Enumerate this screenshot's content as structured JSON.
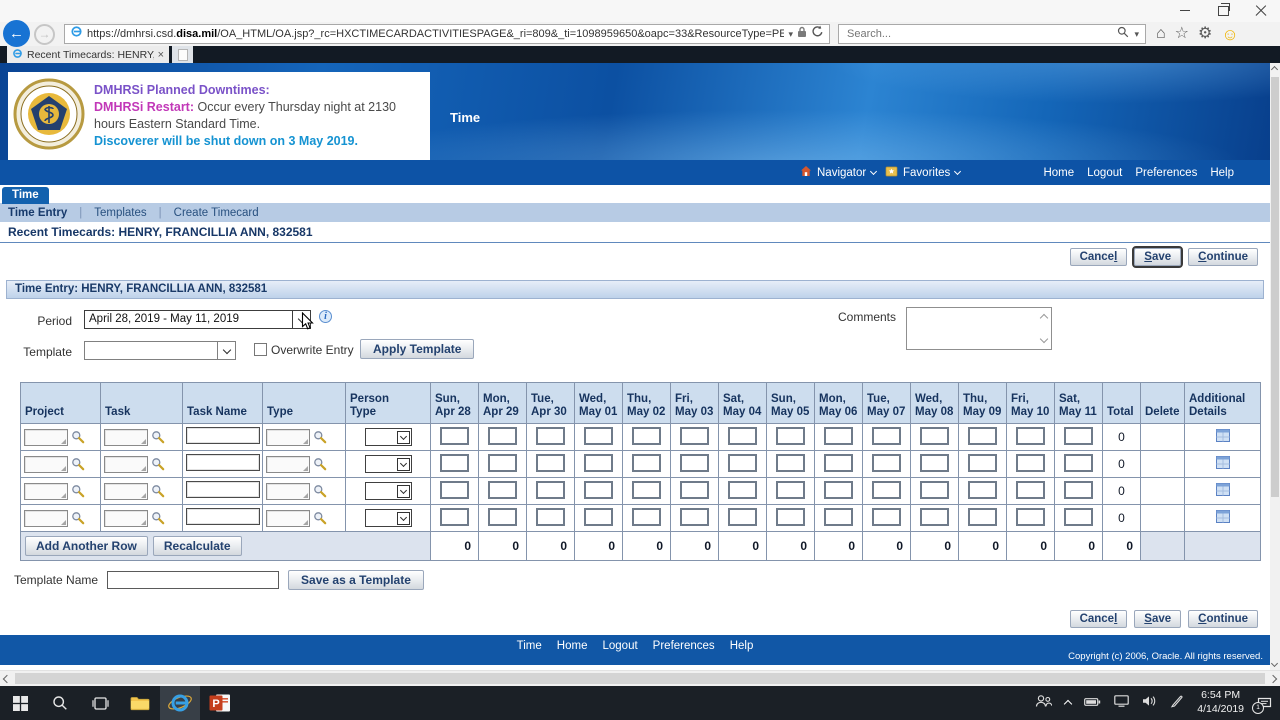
{
  "browser": {
    "url_prefix": "https://dmhrsi.csd.",
    "url_domain": "disa.mil",
    "url_path": "/OA_HTML/OA.jsp?_rc=HXCTIMECARDACTIVITIESPAGE&_ri=809&_ti=1098959650&oapc=33&ResourceType=PERSON&retainAM=Y&Actic",
    "search_placeholder": "Search...",
    "tab_title": "Recent Timecards: HENRY, ...",
    "icons": {
      "back": "←",
      "forward": "→",
      "url_caret": "▾",
      "search_caret": "▾",
      "home": "⌂",
      "star": "☆",
      "gear": "⚙",
      "smiley": "☺",
      "tab_close": "×",
      "info": "i"
    }
  },
  "banner": {
    "title": "DMHRSi Planned Downtimes:",
    "restart_label": "DMHRSi Restart:",
    "restart_text": " Occur every Thursday night at 2130 hours Eastern Standard Time.",
    "discoverer_text": "Discoverer will be shut down on 3 May 2019.",
    "colors": {
      "title": "#7a52c8",
      "restart": "#c238b8",
      "body": "#4a4a4a",
      "discoverer": "#1593d2"
    }
  },
  "header": {
    "app_title": "Time",
    "navigator_label": "Navigator",
    "favorites_label": "Favorites",
    "links": [
      "Home",
      "Logout",
      "Preferences",
      "Help"
    ]
  },
  "nav": {
    "tab": "Time",
    "items": [
      "Time Entry",
      "Templates",
      "Create Timecard"
    ]
  },
  "breadcrumb": "Recent Timecards: HENRY, FRANCILLIA ANN, 832581",
  "section_title": "Time Entry: HENRY, FRANCILLIA ANN, 832581",
  "actions": {
    "cancel": {
      "pre": "Cance",
      "u": "l",
      "post": ""
    },
    "save": {
      "pre": "",
      "u": "S",
      "post": "ave"
    },
    "continue": {
      "pre": "",
      "u": "C",
      "post": "ontinue"
    }
  },
  "form": {
    "period_label": "Period",
    "period_value": "April 28, 2019 - May 11, 2019",
    "template_label": "Template",
    "template_value": "",
    "overwrite_label": "Overwrite Entry",
    "apply_template_label": "Apply Template",
    "comments_label": "Comments",
    "comments_value": "",
    "template_name_label": "Template Name",
    "template_name_value": "",
    "save_as_template_label": "Save as a Template"
  },
  "timecard_table": {
    "col_headers": [
      "Project",
      "Task",
      "Task Name",
      "Type"
    ],
    "person_type_header": [
      "Person",
      "Type"
    ],
    "day_headers": [
      [
        "Sun,",
        "Apr 28"
      ],
      [
        "Mon,",
        "Apr 29"
      ],
      [
        "Tue,",
        "Apr 30"
      ],
      [
        "Wed,",
        "May 01"
      ],
      [
        "Thu,",
        "May 02"
      ],
      [
        "Fri,",
        "May 03"
      ],
      [
        "Sat,",
        "May 04"
      ],
      [
        "Sun,",
        "May 05"
      ],
      [
        "Mon,",
        "May 06"
      ],
      [
        "Tue,",
        "May 07"
      ],
      [
        "Wed,",
        "May 08"
      ],
      [
        "Thu,",
        "May 09"
      ],
      [
        "Fri,",
        "May 10"
      ],
      [
        "Sat,",
        "May 11"
      ]
    ],
    "total_header": "Total",
    "delete_header": "Delete",
    "additional_header": [
      "Additional",
      "Details"
    ],
    "rows": [
      {
        "total": "0"
      },
      {
        "total": "0"
      },
      {
        "total": "0"
      },
      {
        "total": "0"
      }
    ],
    "footer": {
      "add_row_label": "Add Another Row",
      "recalculate_label": "Recalculate",
      "day_totals": [
        "0",
        "0",
        "0",
        "0",
        "0",
        "0",
        "0",
        "0",
        "0",
        "0",
        "0",
        "0",
        "0",
        "0"
      ],
      "grand_total": "0"
    }
  },
  "footer": {
    "links": [
      "Time",
      "Home",
      "Logout",
      "Preferences",
      "Help"
    ],
    "copyright": "Copyright (c) 2006, Oracle. All rights reserved."
  },
  "taskbar": {
    "time": "6:54 PM",
    "date": "4/14/2019",
    "notification_count": "1"
  }
}
